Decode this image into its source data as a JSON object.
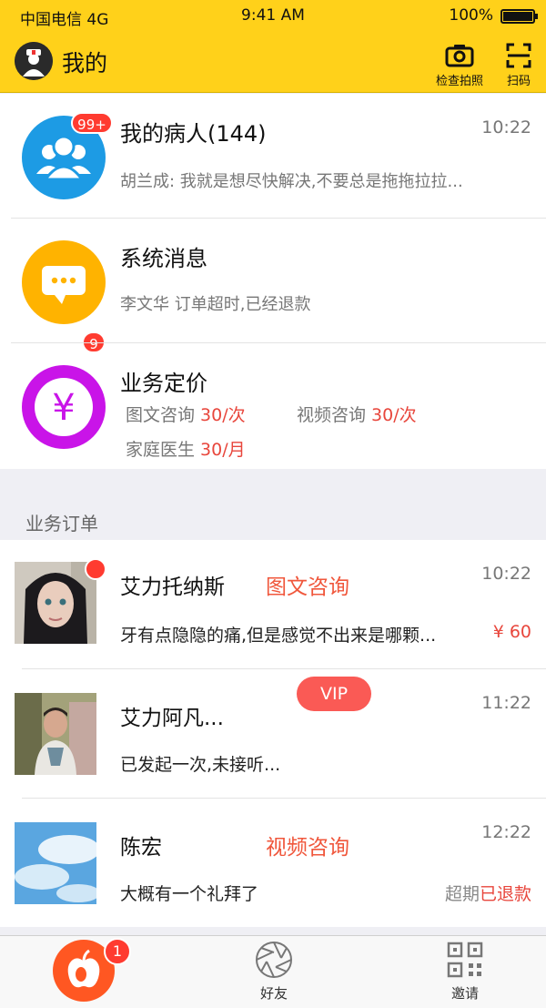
{
  "status_bar": {
    "carrier": "中国电信 4G",
    "time": "9:41 AM",
    "battery": "100%"
  },
  "nav": {
    "title": "我的",
    "camera_label": "检查拍照",
    "scan_label": "扫码"
  },
  "top_list": {
    "patients": {
      "title": "我的病人(144)",
      "badge": "99+",
      "time": "10:22",
      "preview": "胡兰成: 我就是想尽快解决,不要总是拖拖拉拉..."
    },
    "system": {
      "title": "系统消息",
      "badge": "9",
      "preview": "李文华 订单超时,已经退款"
    },
    "pricing": {
      "title": "业务定价",
      "items": [
        {
          "label": "图文咨询",
          "price": "30/次"
        },
        {
          "label": "视频咨询",
          "price": "30/次"
        },
        {
          "label": "家庭医生",
          "price": "30/月"
        }
      ]
    }
  },
  "section_title": "业务订单",
  "orders": [
    {
      "name": "艾力托纳斯",
      "type": "图文咨询",
      "time": "10:22",
      "message": "牙有点隐隐的痛,但是感觉不出来是哪颗...",
      "price": "¥ 60"
    },
    {
      "name": "艾力阿凡...",
      "type": "",
      "badge": "VIP",
      "time": "11:22",
      "message": "已发起一次,未接听..."
    },
    {
      "name": "陈宏",
      "type": "视频咨询",
      "time": "12:22",
      "message": "大概有一个礼拜了",
      "status_gray": "超期",
      "status_red": "已退款"
    }
  ],
  "tabbar": {
    "home_badge": "1",
    "friends_label": "好友",
    "invite_label": "邀请"
  },
  "colors": {
    "accent": "#ffd11a",
    "red": "#ff3b30",
    "orange_text": "#f0573c"
  }
}
